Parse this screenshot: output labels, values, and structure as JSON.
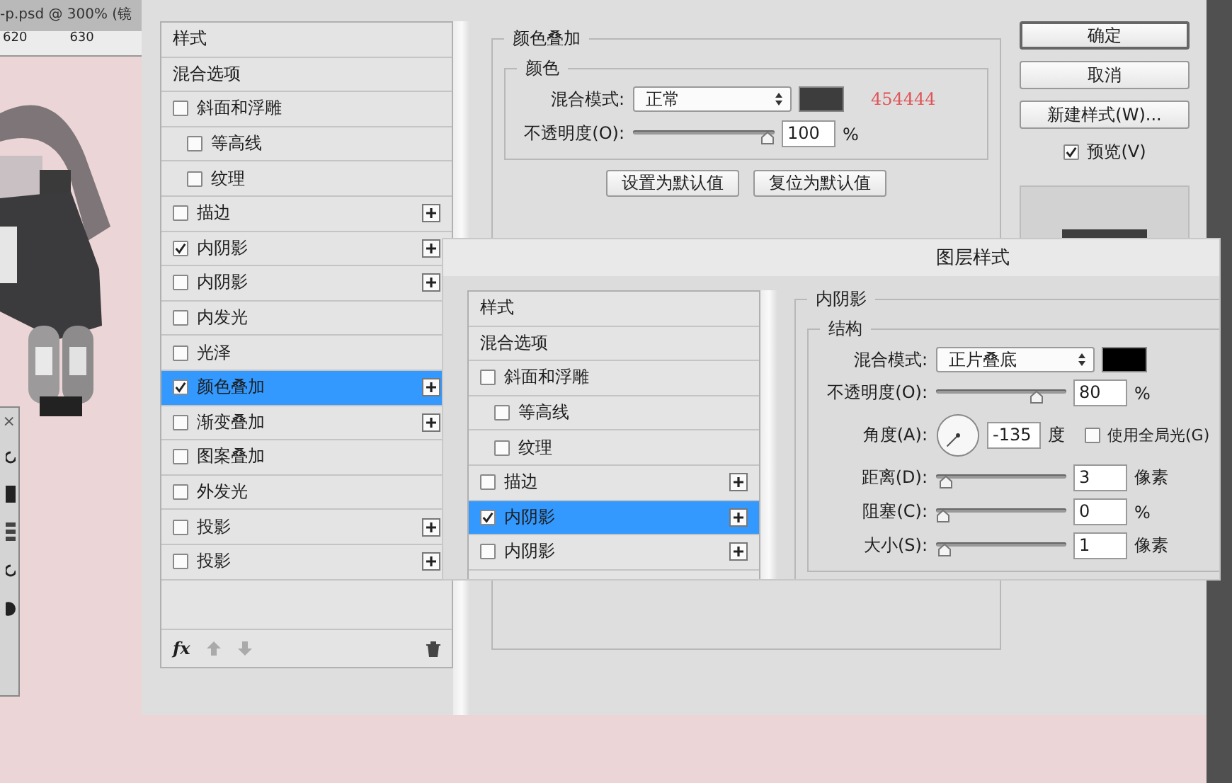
{
  "document": {
    "tab_title": "-p.psd @ 300% (镜",
    "ruler_labels": [
      "620",
      "630"
    ]
  },
  "tool_panel": {
    "close": "×"
  },
  "back_dialog": {
    "styles": [
      {
        "label": "样式",
        "kind": "header",
        "selected": false
      },
      {
        "label": "混合选项",
        "kind": "plain",
        "selected": false
      },
      {
        "label": "斜面和浮雕",
        "kind": "check",
        "checked": false,
        "selected": false,
        "add": false
      },
      {
        "label": "等高线",
        "kind": "subcheck",
        "checked": false,
        "selected": false,
        "add": false
      },
      {
        "label": "纹理",
        "kind": "subcheck",
        "checked": false,
        "selected": false,
        "add": false
      },
      {
        "label": "描边",
        "kind": "check",
        "checked": false,
        "selected": false,
        "add": true
      },
      {
        "label": "内阴影",
        "kind": "check",
        "checked": true,
        "selected": false,
        "add": true
      },
      {
        "label": "内阴影",
        "kind": "check",
        "checked": false,
        "selected": false,
        "add": true
      },
      {
        "label": "内发光",
        "kind": "check",
        "checked": false,
        "selected": false,
        "add": false
      },
      {
        "label": "光泽",
        "kind": "check",
        "checked": false,
        "selected": false,
        "add": false
      },
      {
        "label": "颜色叠加",
        "kind": "check",
        "checked": true,
        "selected": true,
        "add": true
      },
      {
        "label": "渐变叠加",
        "kind": "check",
        "checked": false,
        "selected": false,
        "add": true
      },
      {
        "label": "图案叠加",
        "kind": "check",
        "checked": false,
        "selected": false,
        "add": false
      },
      {
        "label": "外发光",
        "kind": "check",
        "checked": false,
        "selected": false,
        "add": false
      },
      {
        "label": "投影",
        "kind": "check",
        "checked": false,
        "selected": false,
        "add": true
      },
      {
        "label": "投影",
        "kind": "check",
        "checked": false,
        "selected": false,
        "add": true
      }
    ],
    "footer_fx": "fx",
    "section_title": "颜色叠加",
    "group_title": "颜色",
    "blend_label": "混合模式:",
    "blend_value": "正常",
    "note": "454444",
    "opacity": {
      "label": "不透明度(O):",
      "level": 1,
      "value": "100",
      "unit": "%"
    },
    "buttons": [
      "设置为默认值",
      "复位为默认值"
    ],
    "actions": [
      "确定",
      "取消",
      "新建样式(W)..."
    ],
    "preview": {
      "label": "预览(V)",
      "checked": true
    }
  },
  "front_dialog": {
    "title": "图层样式",
    "styles": [
      {
        "label": "样式",
        "kind": "header",
        "selected": false
      },
      {
        "label": "混合选项",
        "kind": "plain",
        "selected": false
      },
      {
        "label": "斜面和浮雕",
        "kind": "check",
        "checked": false,
        "selected": false,
        "add": false
      },
      {
        "label": "等高线",
        "kind": "subcheck",
        "checked": false,
        "selected": false,
        "add": false
      },
      {
        "label": "纹理",
        "kind": "subcheck",
        "checked": false,
        "selected": false,
        "add": false
      },
      {
        "label": "描边",
        "kind": "check",
        "checked": false,
        "selected": false,
        "add": true
      },
      {
        "label": "内阴影",
        "kind": "check",
        "checked": true,
        "selected": true,
        "add": true
      },
      {
        "label": "内阴影",
        "kind": "check",
        "checked": false,
        "selected": false,
        "add": true
      }
    ],
    "section_title": "内阴影",
    "group_title": "结构",
    "blend_label": "混合模式:",
    "blend_value": "正片叠底",
    "opacity": {
      "label": "不透明度(O):",
      "level": 0.8,
      "value": "80",
      "unit": "%"
    },
    "angle": {
      "label": "角度(A):",
      "value": "-135",
      "unit": "度"
    },
    "global_light": {
      "label": "使用全局光(G)",
      "checked": false
    },
    "sliders": [
      {
        "label": "距离(D):",
        "level": 0.02,
        "value": "3",
        "unit": "像素"
      },
      {
        "label": "阻塞(C):",
        "level": 0,
        "value": "0",
        "unit": "%"
      },
      {
        "label": "大小(S):",
        "level": 0.01,
        "value": "1",
        "unit": "像素"
      }
    ]
  }
}
